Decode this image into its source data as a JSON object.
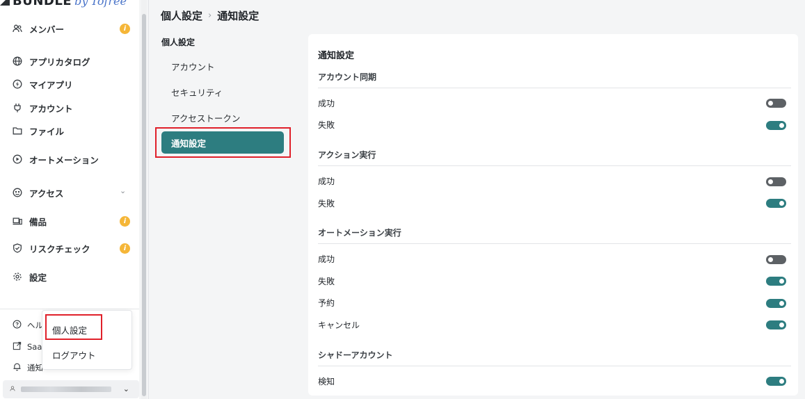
{
  "sidebar": {
    "logo": {
      "brand": "BUNDLE",
      "by": "by",
      "partner": "Tofree"
    },
    "items": [
      {
        "label": "メンバー",
        "icon": "members-icon",
        "badge": "i"
      },
      {
        "label": "アプリカタログ",
        "icon": "globe-icon"
      },
      {
        "label": "マイアプリ",
        "icon": "bolt-icon"
      },
      {
        "label": "アカウント",
        "icon": "plug-icon"
      },
      {
        "label": "ファイル",
        "icon": "folder-icon"
      },
      {
        "label": "オートメーション",
        "icon": "play-icon"
      },
      {
        "label": "アクセス",
        "icon": "access-icon",
        "chevron": "⌄"
      },
      {
        "label": "備品",
        "icon": "devices-icon",
        "badge": "i"
      },
      {
        "label": "リスクチェック",
        "icon": "shield-check-icon",
        "badge": "i"
      },
      {
        "label": "設定",
        "icon": "gear-icon"
      }
    ],
    "bottom": [
      {
        "label": "ヘル",
        "icon": "help-icon"
      },
      {
        "label": "Saa",
        "icon": "external-link-icon"
      },
      {
        "label": "通知",
        "icon": "bell-icon"
      }
    ],
    "user_chevron": "⌄"
  },
  "popup": {
    "items": [
      "個人設定",
      "ログアウト"
    ]
  },
  "breadcrumb": {
    "parent": "個人設定",
    "separator": "›",
    "current": "通知設定"
  },
  "submenu": {
    "title": "個人設定",
    "items": [
      "アカウント",
      "セキュリティ",
      "アクセストークン"
    ],
    "active": "通知設定"
  },
  "panel": {
    "title": "通知設定",
    "sections": [
      {
        "heading": "アカウント同期",
        "rows": [
          {
            "label": "成功",
            "enabled": false
          },
          {
            "label": "失敗",
            "enabled": true
          }
        ]
      },
      {
        "heading": "アクション実行",
        "rows": [
          {
            "label": "成功",
            "enabled": false
          },
          {
            "label": "失敗",
            "enabled": true
          }
        ]
      },
      {
        "heading": "オートメーション実行",
        "rows": [
          {
            "label": "成功",
            "enabled": false
          },
          {
            "label": "失敗",
            "enabled": true
          },
          {
            "label": "予約",
            "enabled": true
          },
          {
            "label": "キャンセル",
            "enabled": true
          }
        ]
      },
      {
        "heading": "シャドーアカウント",
        "rows": [
          {
            "label": "検知",
            "enabled": true
          }
        ]
      }
    ]
  },
  "colors": {
    "accent": "#2d7d80",
    "badge": "#f5b638",
    "highlight": "#e0202a",
    "toggle_off": "#5d6165"
  }
}
